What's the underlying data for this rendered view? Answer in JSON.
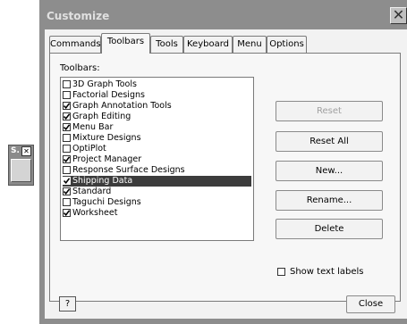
{
  "mini_toolbar": {
    "caption": "S.",
    "close_glyph": "✕"
  },
  "dialog": {
    "title": "Customize",
    "close_glyph": "✕",
    "tabs": [
      {
        "label": "Commands",
        "active": false
      },
      {
        "label": "Toolbars",
        "active": true
      },
      {
        "label": "Tools",
        "active": false
      },
      {
        "label": "Keyboard",
        "active": false
      },
      {
        "label": "Menu",
        "active": false
      },
      {
        "label": "Options",
        "active": false
      }
    ],
    "toolbars_label": "Toolbars:",
    "toolbars": [
      {
        "label": "3D Graph Tools",
        "checked": false,
        "selected": false
      },
      {
        "label": "Factorial Designs",
        "checked": false,
        "selected": false
      },
      {
        "label": "Graph Annotation Tools",
        "checked": true,
        "selected": false
      },
      {
        "label": "Graph Editing",
        "checked": true,
        "selected": false
      },
      {
        "label": "Menu Bar",
        "checked": true,
        "selected": false
      },
      {
        "label": "Mixture Designs",
        "checked": false,
        "selected": false
      },
      {
        "label": "OptiPlot",
        "checked": false,
        "selected": false
      },
      {
        "label": "Project Manager",
        "checked": true,
        "selected": false
      },
      {
        "label": "Response Surface Designs",
        "checked": false,
        "selected": false
      },
      {
        "label": "Shipping Data",
        "checked": true,
        "selected": true
      },
      {
        "label": "Standard",
        "checked": true,
        "selected": false
      },
      {
        "label": "Taguchi Designs",
        "checked": false,
        "selected": false
      },
      {
        "label": "Worksheet",
        "checked": true,
        "selected": false
      }
    ],
    "buttons": {
      "reset": "Reset",
      "reset_all": "Reset All",
      "new": "New...",
      "rename": "Rename...",
      "delete": "Delete"
    },
    "show_text_labels": {
      "label": "Show text labels",
      "checked": false
    },
    "help_glyph": "?",
    "close_label": "Close"
  }
}
